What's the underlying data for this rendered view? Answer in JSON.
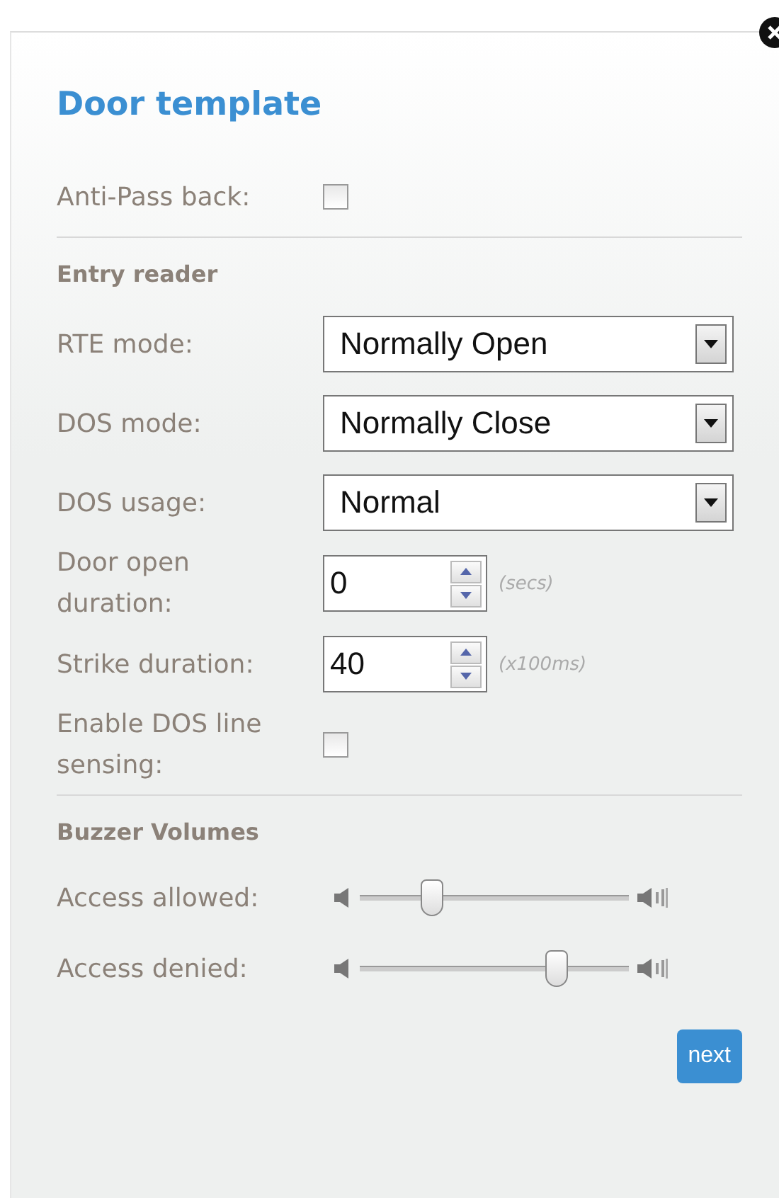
{
  "title": "Door template",
  "anti_pass_back": {
    "label": "Anti-Pass back:",
    "checked": false
  },
  "entry_reader": {
    "heading": "Entry reader",
    "fields": [
      {
        "kind": "select",
        "label": "RTE mode:",
        "value": "Normally Open"
      },
      {
        "kind": "select",
        "label": "DOS mode:",
        "value": "Normally Close"
      },
      {
        "kind": "select",
        "label": "DOS usage:",
        "value": "Normal"
      },
      {
        "kind": "spinner",
        "label": "Door open duration:",
        "value": "0",
        "unit": "(secs)"
      },
      {
        "kind": "spinner",
        "label": "Strike duration:",
        "value": "40",
        "unit": "(x100ms)"
      },
      {
        "kind": "checkbox",
        "label": "Enable DOS line sensing:",
        "checked": false
      }
    ]
  },
  "buzzer_volumes": {
    "heading": "Buzzer Volumes",
    "sliders": [
      {
        "label": "Access allowed:",
        "level": 0.27
      },
      {
        "label": "Access denied:",
        "level": 0.73
      }
    ]
  },
  "next_button": "next"
}
